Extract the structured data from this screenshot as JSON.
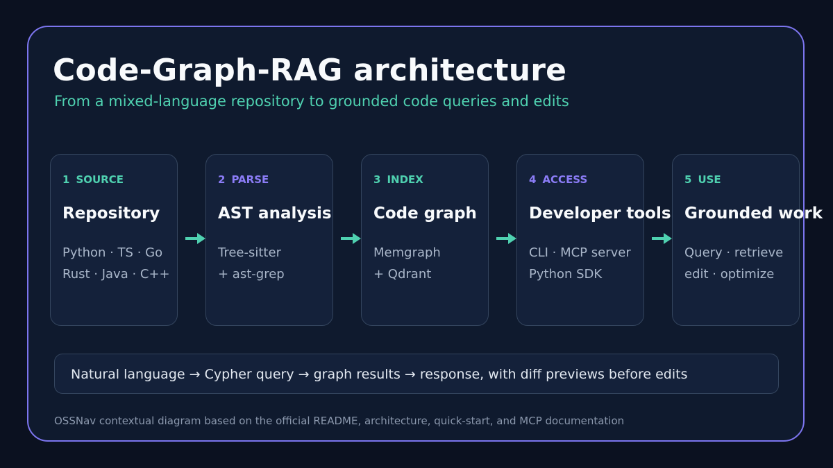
{
  "title": "Code-Graph-RAG architecture",
  "subtitle": "From a mixed-language repository to grounded code queries and edits",
  "colors": {
    "accent_teal": "#4fd1b0",
    "accent_violet": "#8b7cf6",
    "frame_border": "#7c75ee",
    "background": "#0b1120"
  },
  "stages": [
    {
      "num": "1",
      "tag": "SOURCE",
      "name": "Repository",
      "lines": [
        "Python · TS · Go",
        "Rust · Java · C++"
      ]
    },
    {
      "num": "2",
      "tag": "PARSE",
      "name": "AST analysis",
      "lines": [
        "Tree-sitter",
        "+ ast-grep"
      ]
    },
    {
      "num": "3",
      "tag": "INDEX",
      "name": "Code graph",
      "lines": [
        "Memgraph",
        "+ Qdrant"
      ]
    },
    {
      "num": "4",
      "tag": "ACCESS",
      "name": "Developer tools",
      "lines": [
        "CLI · MCP server",
        "Python SDK"
      ]
    },
    {
      "num": "5",
      "tag": "USE",
      "name": "Grounded work",
      "lines": [
        "Query · retrieve",
        "edit · optimize"
      ]
    }
  ],
  "arrow_icon": "right-arrow-icon",
  "flow_text": "Natural language → Cypher query → graph results → response, with diff previews before edits",
  "footer": "OSSNav contextual diagram based on the official README, architecture, quick-start, and MCP documentation"
}
